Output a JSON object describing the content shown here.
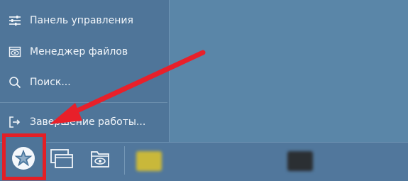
{
  "start_menu": {
    "items": [
      {
        "label": "Панель управления",
        "icon": "sliders-icon"
      },
      {
        "label": "Менеджер файлов",
        "icon": "file-manager-icon"
      },
      {
        "label": "Поиск...",
        "icon": "search-icon"
      },
      {
        "label": "Завершение работы...",
        "icon": "logout-icon"
      }
    ]
  },
  "taskbar": {
    "start_button_icon": "star-menu-icon",
    "buttons": [
      {
        "icon": "windows-switcher-icon"
      },
      {
        "icon": "file-manager-icon"
      }
    ],
    "tasks": [
      {
        "label": "",
        "icon": "app-icon-yellow"
      },
      {
        "label": "",
        "icon": "app-icon-dark"
      }
    ]
  },
  "annotation": {
    "arrow_color": "#e8202a",
    "highlight_color": "#e31f26"
  },
  "colors": {
    "desktop": "#5a86a8",
    "menu": "#4f7599",
    "taskbar": "#51779c"
  }
}
